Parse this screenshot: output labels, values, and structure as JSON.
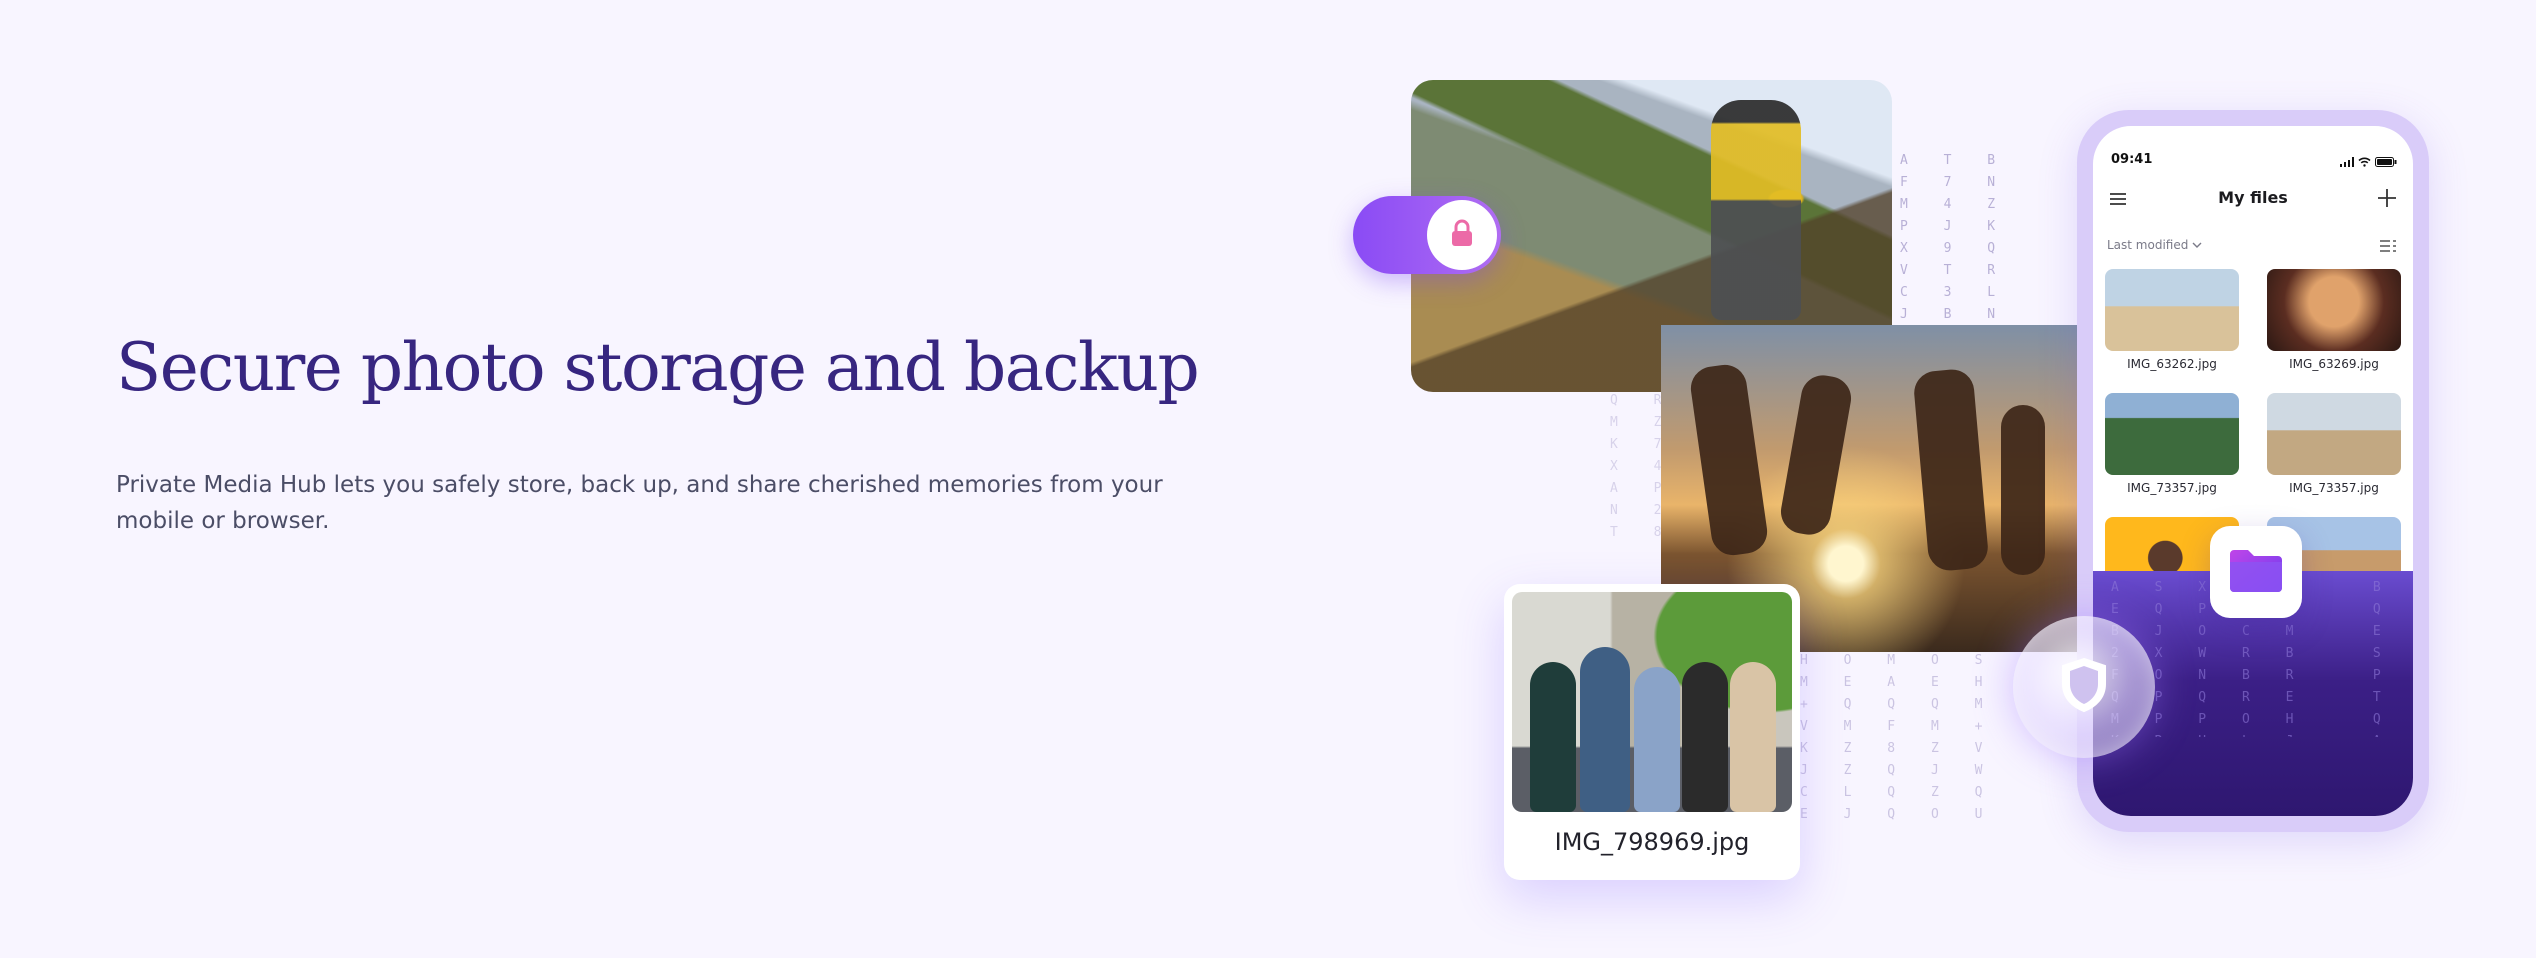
{
  "hero": {
    "title": "Secure photo storage and backup",
    "description": "Private Media Hub lets you safely store, back up, and share cherished memories from your mobile or browser."
  },
  "photo_card": {
    "filename": "IMG_798969.jpg"
  },
  "phone": {
    "status_time": "09:41",
    "title": "My files",
    "sort_label": "Last modified",
    "files": [
      {
        "name": "IMG_63262.jpg"
      },
      {
        "name": "IMG_63269.jpg"
      },
      {
        "name": "IMG_73357.jpg"
      },
      {
        "name": "IMG_73357.jpg"
      },
      {
        "name": ""
      },
      {
        "name": ""
      }
    ]
  },
  "icons": {
    "toggle": "lock-icon",
    "folder": "folder-icon",
    "shield": "shield-icon",
    "menu": "hamburger-menu-icon",
    "add": "plus-icon",
    "sort": "chevron-down-icon",
    "view": "list-view-icon"
  },
  "colors": {
    "background": "#f8f5ff",
    "headline": "#372680",
    "body_text": "#4b4d66",
    "accent": "#8a4bf5",
    "phone_frame": "#d9ccf9",
    "phone_fade": "#2e1770"
  }
}
